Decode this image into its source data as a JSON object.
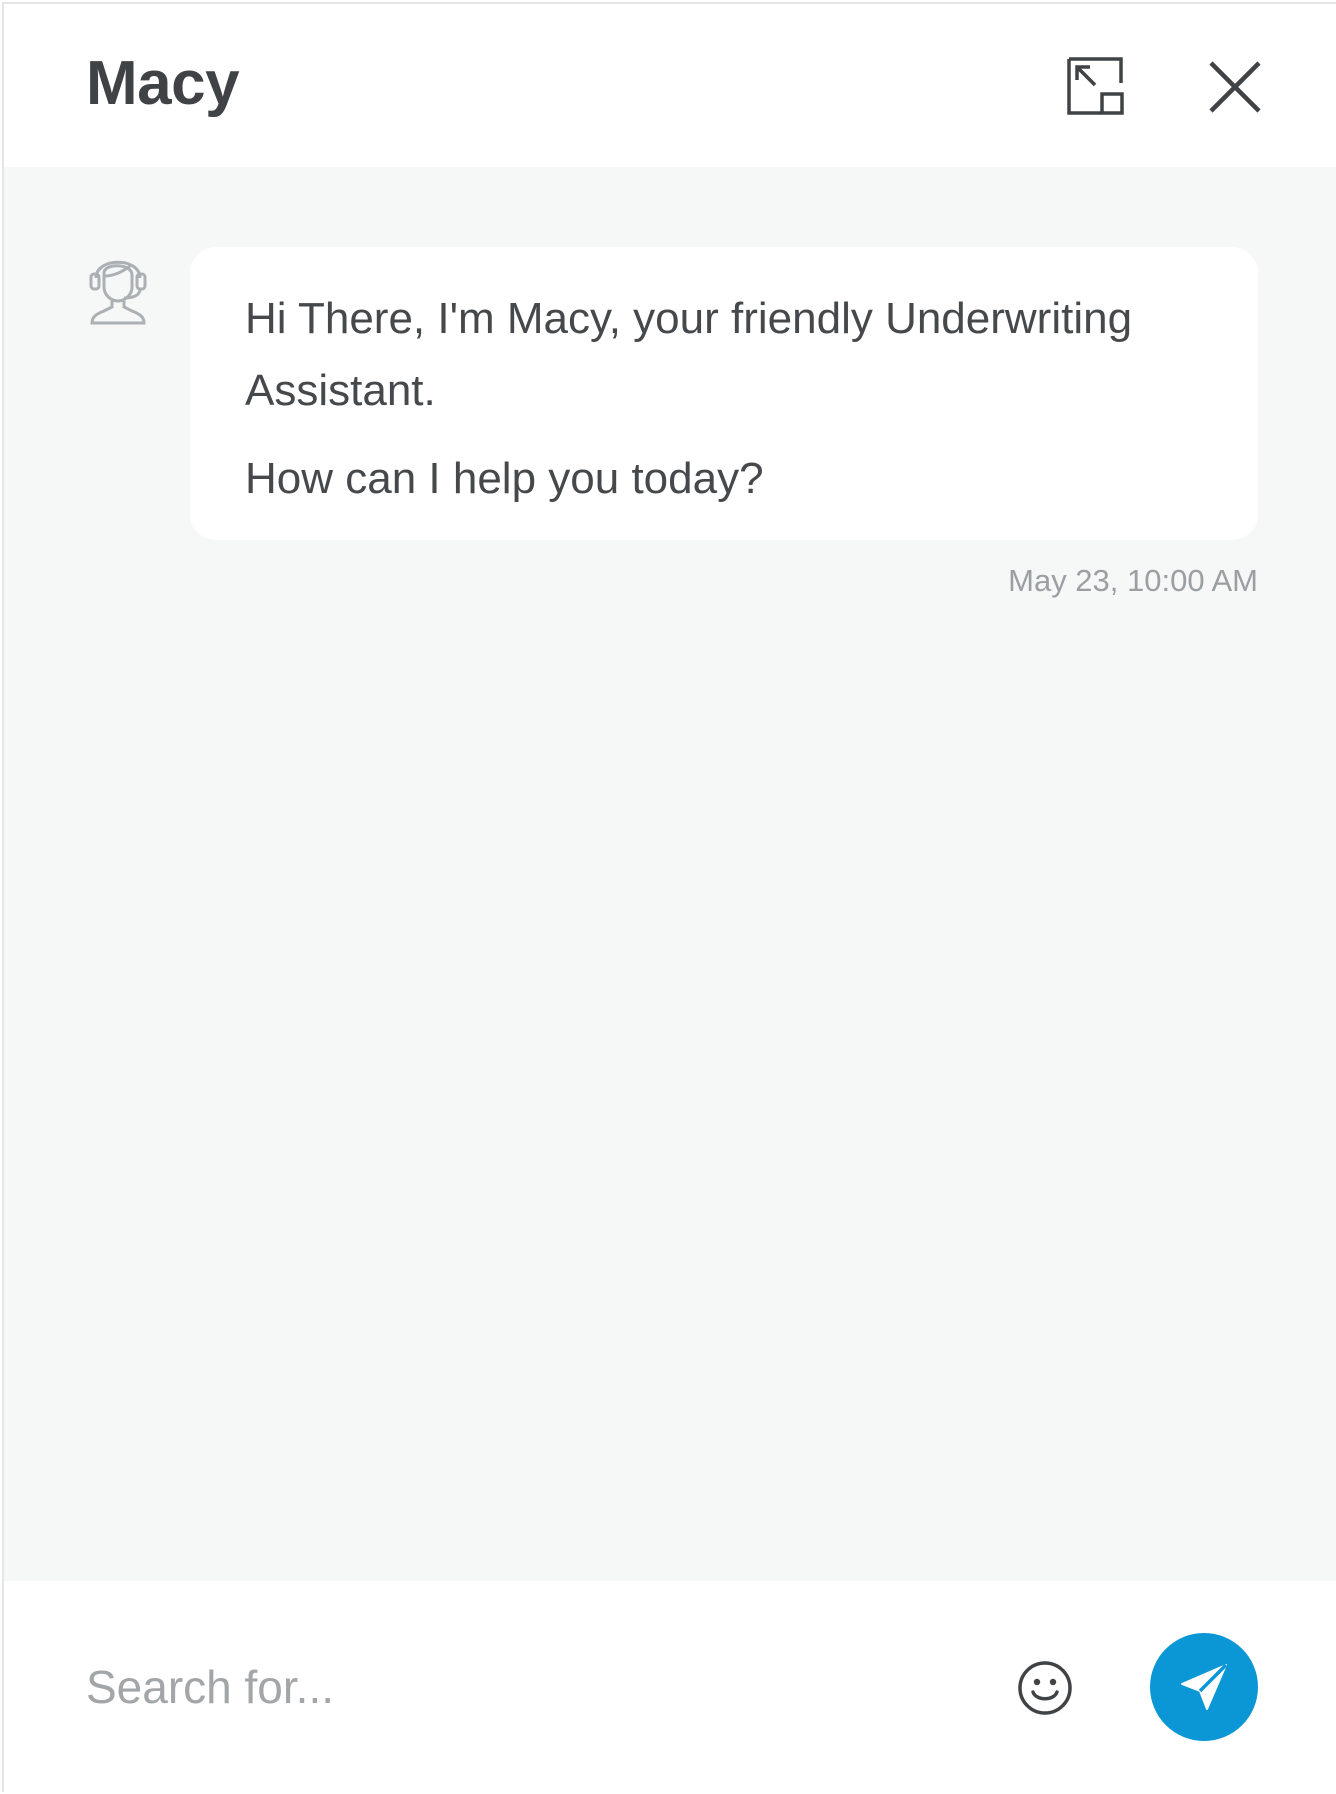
{
  "header": {
    "title": "Macy",
    "expand_icon": "expand-icon",
    "close_icon": "close-icon"
  },
  "conversation": {
    "avatar_icon": "support-agent-headset-icon",
    "messages": [
      {
        "sender": "bot",
        "lines": [
          "Hi There, I'm Macy, your friendly Underwriting Assistant.",
          "How can I help you today?"
        ],
        "timestamp": "May 23, 10:00 AM"
      }
    ]
  },
  "composer": {
    "placeholder": "Search for...",
    "value": "",
    "emoji_icon": "smiley-icon",
    "send_icon": "paper-plane-icon"
  },
  "colors": {
    "accent": "#0b96d6",
    "chat_background": "#f6f7f7",
    "bubble_background": "#ffffff",
    "text": "#45494c",
    "muted_text": "#9a9fa3"
  }
}
